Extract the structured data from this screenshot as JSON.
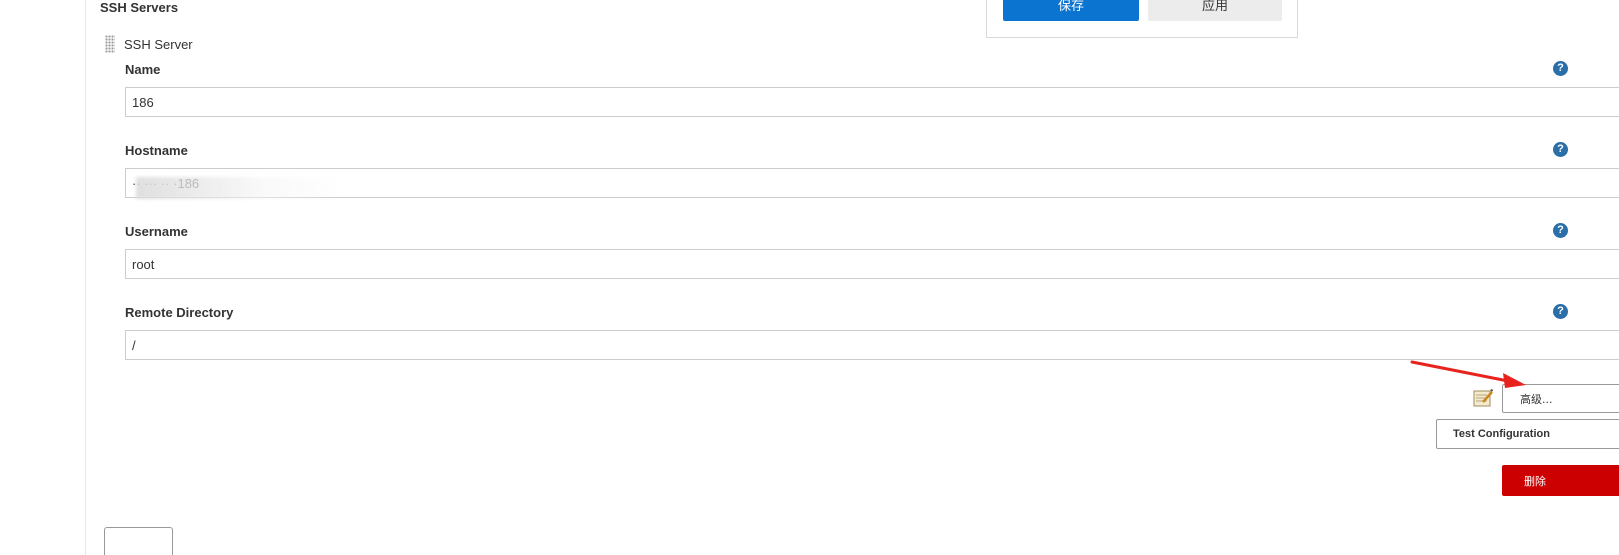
{
  "section": {
    "title": "SSH Servers",
    "server_title": "SSH Server"
  },
  "save_bar": {
    "save_label": "保存",
    "apply_label": "应用"
  },
  "fields": {
    "name": {
      "label": "Name",
      "value": "186"
    },
    "hostname": {
      "label": "Hostname",
      "value": "·· ··· ·· ·186"
    },
    "username": {
      "label": "Username",
      "value": "root"
    },
    "remote_directory": {
      "label": "Remote Directory",
      "value": "/"
    }
  },
  "help_glyph": "?",
  "buttons": {
    "advanced_label": "高级...",
    "test_configuration_label": "Test Configuration",
    "delete_label": "删除"
  },
  "icons": {
    "help": "help-icon",
    "notepad": "notepad-icon",
    "drag_handle": "drag-handle-icon",
    "arrow": "red-arrow-annotation"
  },
  "colors": {
    "primary": "#0b74d1",
    "danger": "#cc0000",
    "help": "#2a6fa8",
    "annotation_arrow": "#e8231e"
  }
}
